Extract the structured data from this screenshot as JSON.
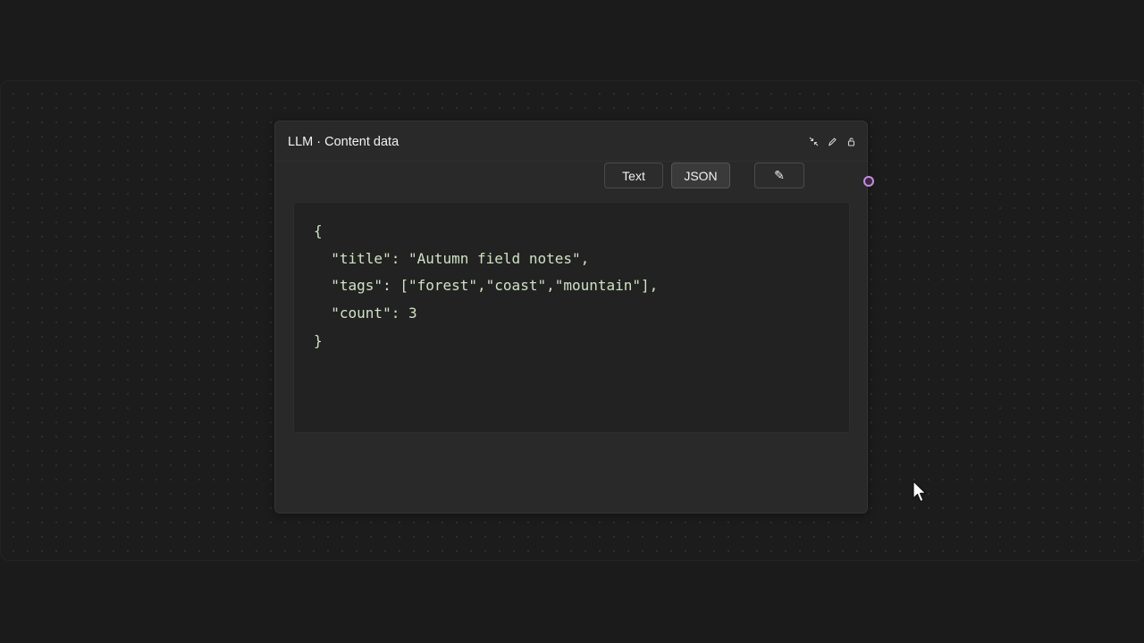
{
  "node": {
    "title": "LLM · Content data",
    "header_icons": [
      "collapse-icon",
      "pencil-icon",
      "lock-icon"
    ]
  },
  "toolbar": {
    "text_label": "Text",
    "json_label": "JSON",
    "edit_label": "✎",
    "selected": "JSON"
  },
  "code": {
    "lines": [
      "{",
      "  \"title\": \"Autumn field notes\",",
      "  \"tags\": [\"forest\",\"coast\",\"mountain\"],",
      "  \"count\": 3",
      "}"
    ]
  },
  "colors": {
    "background": "#1b1b1b",
    "node_background": "#292929",
    "code_text": "#cfe3c3",
    "handle": "#c88ae0"
  }
}
